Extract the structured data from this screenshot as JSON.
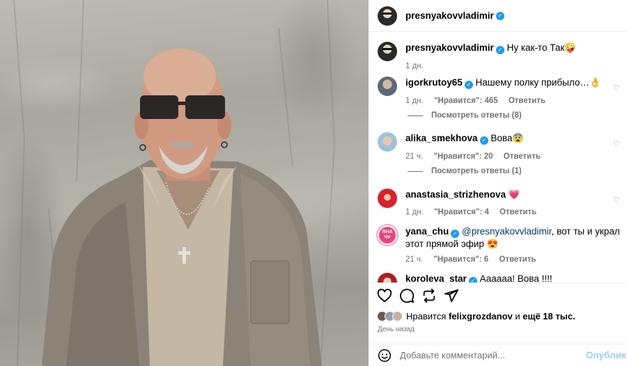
{
  "post": {
    "author": "presnyakovvladimir",
    "caption": "Ну как-то Так🤪",
    "caption_age": "1 дн."
  },
  "comments": [
    {
      "user": "igorkrutoy65",
      "verified": true,
      "text": "Нашему полку прибыло…👌",
      "age": "1 дн.",
      "likes": "\"Нравится\": 465",
      "reply": "Ответить",
      "replies": "Посмотреть ответы (8)"
    },
    {
      "user": "alika_smekhova",
      "verified": true,
      "text": "Вова😨",
      "age": "21 ч.",
      "likes": "\"Нравится\": 20",
      "reply": "Ответить",
      "replies": "Посмотреть ответы (1)"
    },
    {
      "user": "anastasia_strizhenova",
      "verified": false,
      "text": "💗",
      "age": "1 дн.",
      "likes": "\"Нравится\": 4",
      "reply": "Ответить"
    },
    {
      "user": "yana_chu",
      "verified": true,
      "mention": "@presnyakovvladimir",
      "text": ", вот ты и украл этот прямой эфир 😍",
      "age": "21 ч.",
      "likes": "\"Нравится\": 6",
      "reply": "Ответить",
      "avatar_text": "ЯНА ЧУ"
    },
    {
      "user": "koroleva_star",
      "verified": true,
      "text": "Аааааа! Вова !!!!"
    }
  ],
  "actions": {
    "icons": [
      "heart-icon",
      "comment-icon",
      "repost-icon",
      "share-icon"
    ]
  },
  "likes": {
    "prefix": "Нравится",
    "user": "felixgrozdanov",
    "middle": "и",
    "rest": "ещё 18 тыс."
  },
  "time_ago": "День назад",
  "composer": {
    "placeholder": "Добавьте комментарий...",
    "publish": "Опубликовать"
  },
  "colors": {
    "verified": "#1d9bf0",
    "meta": "#737373",
    "publish": "#9fcdf6"
  }
}
